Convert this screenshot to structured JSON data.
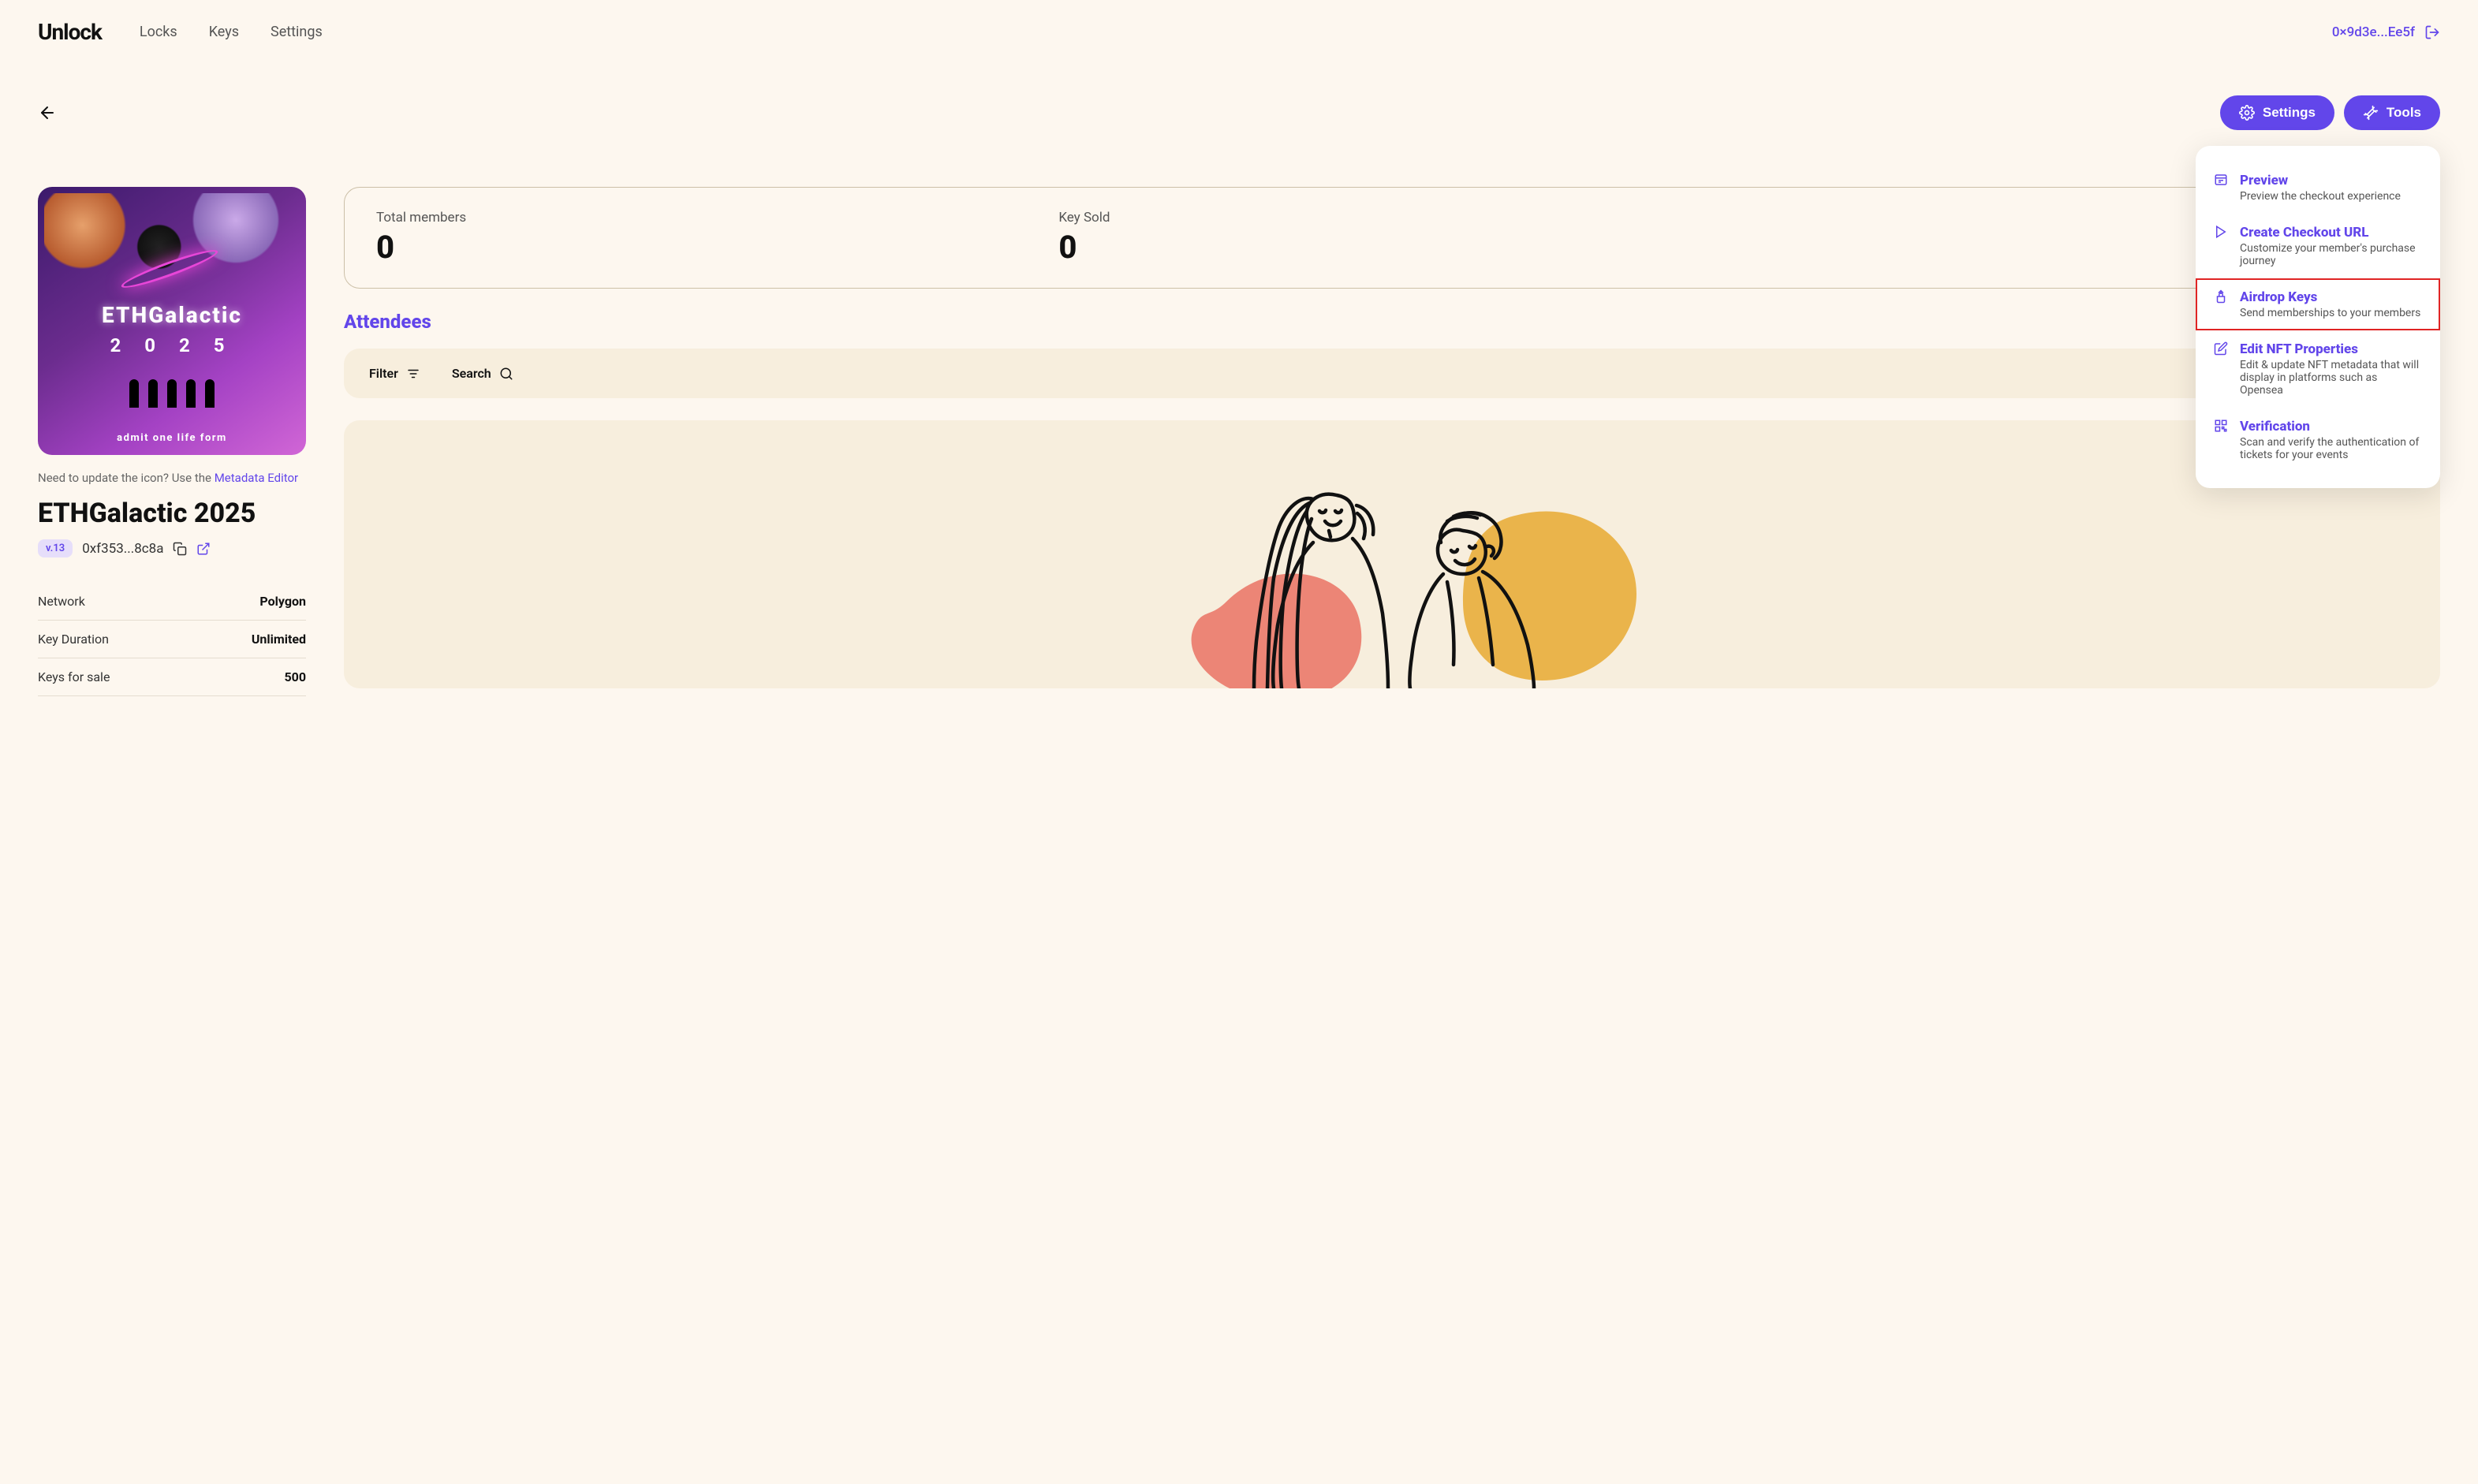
{
  "header": {
    "logo": "Unlock",
    "nav": {
      "locks": "Locks",
      "keys": "Keys",
      "settings": "Settings"
    },
    "wallet": "0×9d3e...Ee5f"
  },
  "actions": {
    "settings": "Settings",
    "tools": "Tools"
  },
  "lock": {
    "image_title": "ETHGalactic",
    "image_year": "2 0 2 5",
    "image_admit": "admit one life form",
    "icon_hint_prefix": "Need to update the icon? Use the ",
    "icon_hint_link": "Metadata Editor",
    "title": "ETHGalactic 2025",
    "version": "v.13",
    "address": "0xf353...8c8a",
    "details": {
      "network_label": "Network",
      "network_value": "Polygon",
      "duration_label": "Key Duration",
      "duration_value": "Unlimited",
      "sale_label": "Keys for sale",
      "sale_value": "500"
    }
  },
  "stats": {
    "members_label": "Total members",
    "members_value": "0",
    "sold_label": "Key Sold",
    "sold_value": "0"
  },
  "attendees": {
    "heading": "Attendees",
    "filter": "Filter",
    "search": "Search"
  },
  "tools_menu": {
    "preview_title": "Preview",
    "preview_desc": "Preview the checkout experience",
    "checkout_title": "Create Checkout URL",
    "checkout_desc": "Customize your member's purchase journey",
    "airdrop_title": "Airdrop Keys",
    "airdrop_desc": "Send memberships to your members",
    "nft_title": "Edit NFT Properties",
    "nft_desc": "Edit & update NFT metadata that will display in platforms such as Opensea",
    "verify_title": "Verification",
    "verify_desc": "Scan and verify the authentication of tickets for your events"
  }
}
